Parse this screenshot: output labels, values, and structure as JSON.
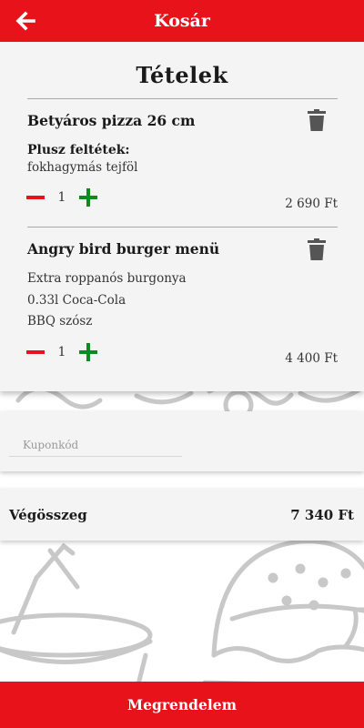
{
  "header": {
    "title": "Kosár",
    "back_icon": "arrow-left-icon"
  },
  "cart": {
    "heading": "Tételek",
    "items": [
      {
        "name": "Betyáros pizza 26 cm",
        "extras_label": "Plusz feltétek:",
        "extras": [
          "fokhagymás tejföl"
        ],
        "quantity": "1",
        "price": "2 690 Ft"
      },
      {
        "name": "Angry bird burger menü",
        "extras": [
          "Extra roppanós burgonya",
          "0.33l Coca-Cola",
          "BBQ szósz"
        ],
        "quantity": "1",
        "price": "4 400 Ft"
      }
    ]
  },
  "coupon": {
    "placeholder": "Kuponkód",
    "value": ""
  },
  "total": {
    "label": "Végösszeg",
    "value": "7 340 Ft"
  },
  "order_button": {
    "label": "Megrendelem"
  },
  "colors": {
    "brand_red": "#e8121b",
    "plus_green": "#0f8a1e",
    "trash_gray": "#555555",
    "card_bg": "#f4f4f4"
  }
}
